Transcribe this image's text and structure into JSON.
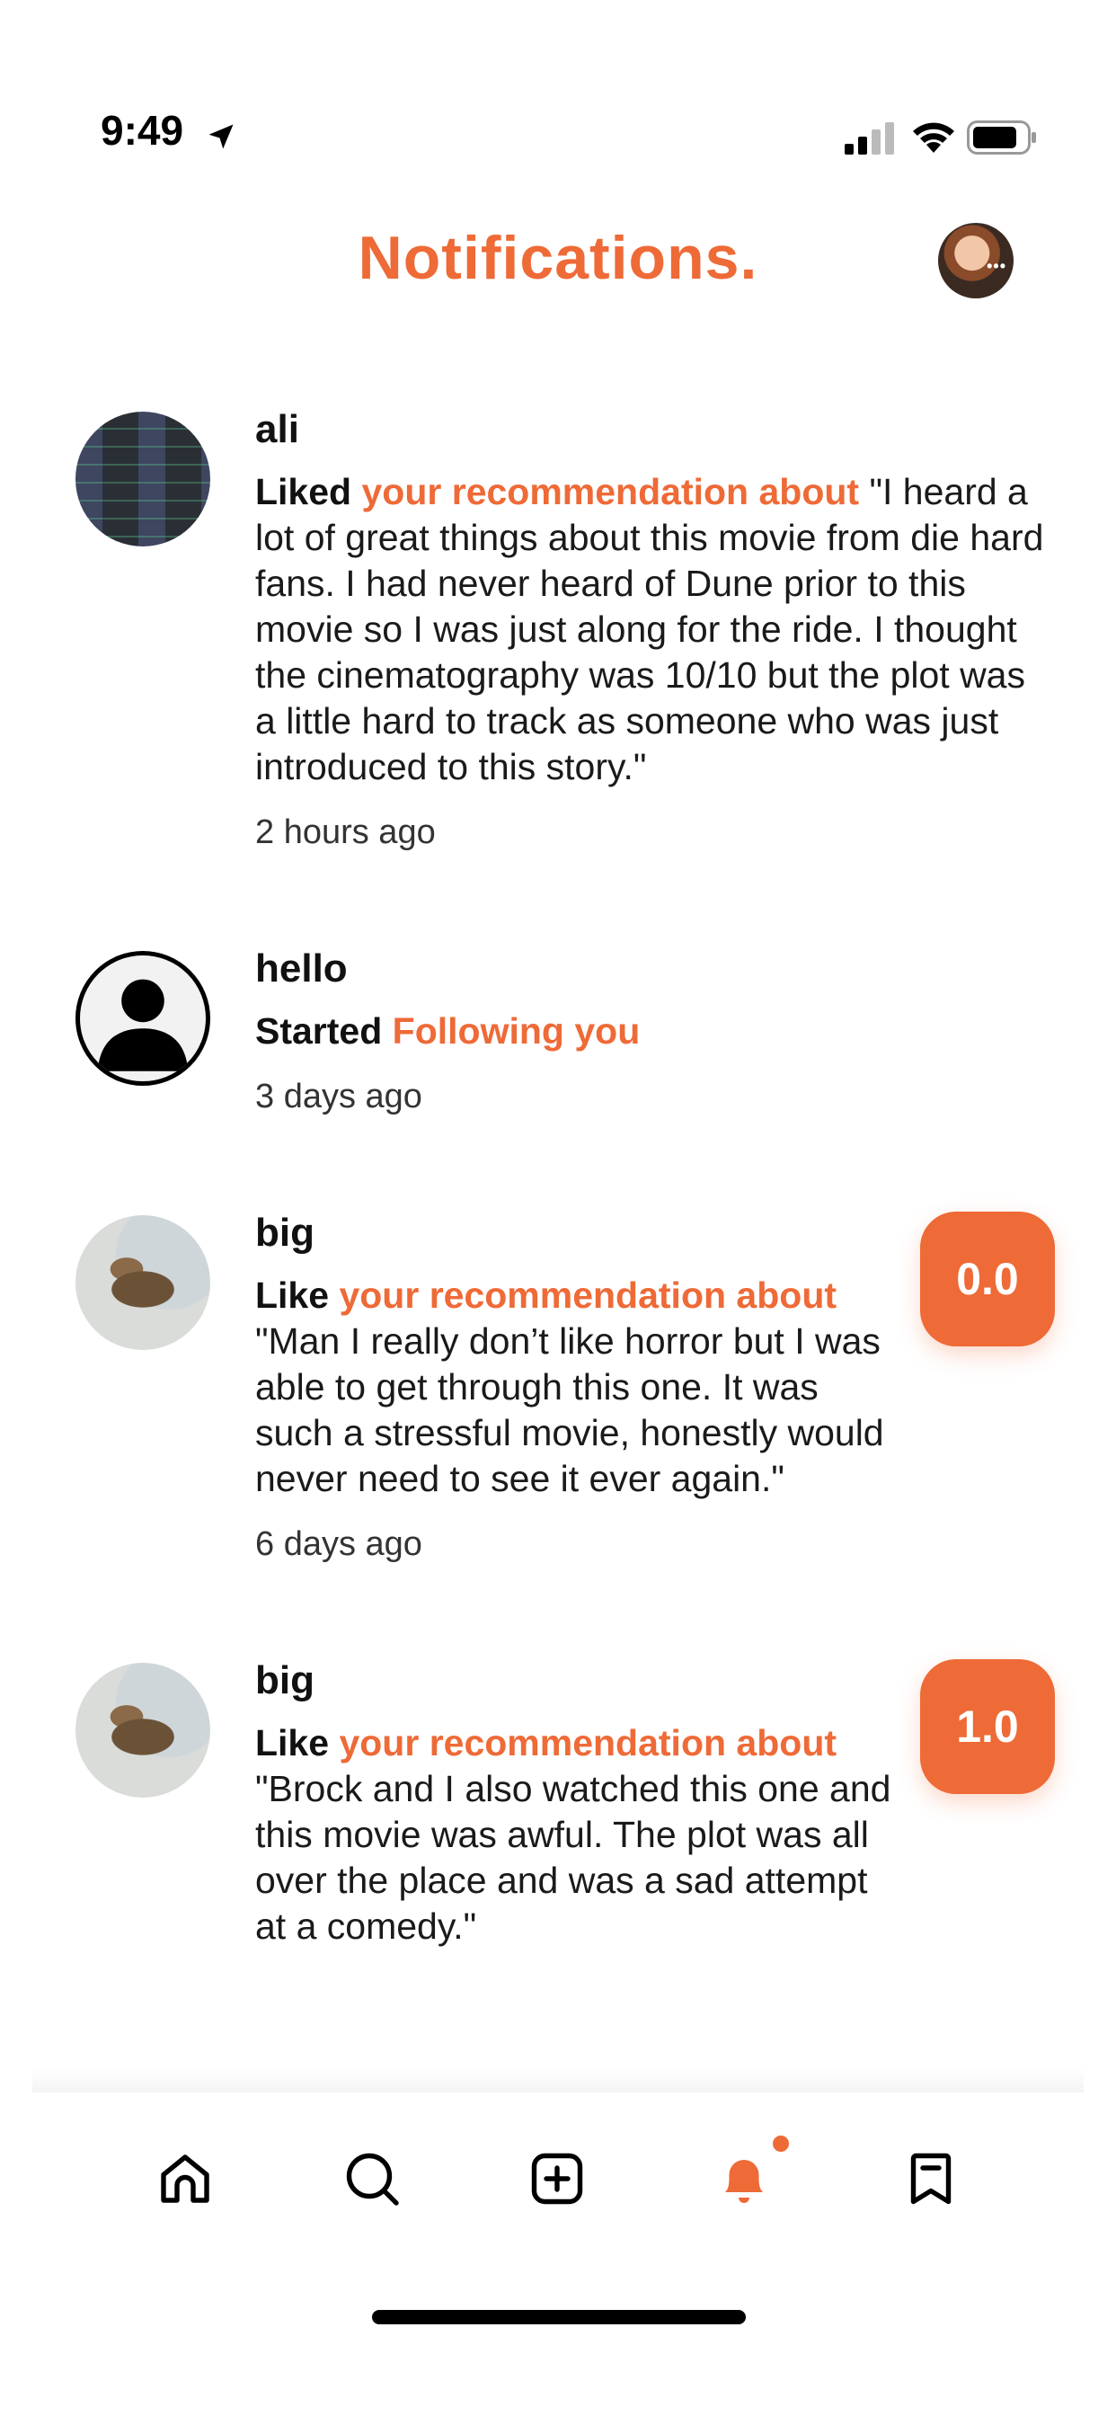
{
  "status_bar": {
    "time": "9:49"
  },
  "header": {
    "title": "Notifications."
  },
  "notifications": [
    {
      "user": "ali",
      "action": "Liked",
      "link": "your recommendation about",
      "text": "\"I heard a lot of great things about this movie from die hard fans. I had never heard of Dune prior to this movie so I was just along for the ride. I thought the cinematography was 10/10 but the plot was a little hard to track as someone who was just introduced to this story.\"",
      "time": "2 hours ago"
    },
    {
      "user": "hello",
      "action": "Started",
      "link": "Following you",
      "text": "",
      "time": "3 days ago"
    },
    {
      "user": "big",
      "action": "Like",
      "link": "your recommendation about",
      "text": "\"Man I really don’t like horror but I was able to get through this one. It was such a stressful movie, honestly would never need to see it ever again.\"",
      "time": "6 days ago",
      "score": "0.0"
    },
    {
      "user": "big",
      "action": "Like",
      "link": "your recommendation about",
      "text": "\"Brock and I also watched this one and this movie was awful. The plot was all over the place and was a sad attempt at a comedy.\"",
      "time": "",
      "score": "1.0"
    }
  ],
  "tab_bar": {
    "icons": [
      "home-icon",
      "search-icon",
      "add-icon",
      "bell-icon",
      "bookmark-icon"
    ],
    "active": "bell-icon"
  },
  "colors": {
    "accent": "#ee6a37",
    "text": "#111111"
  }
}
